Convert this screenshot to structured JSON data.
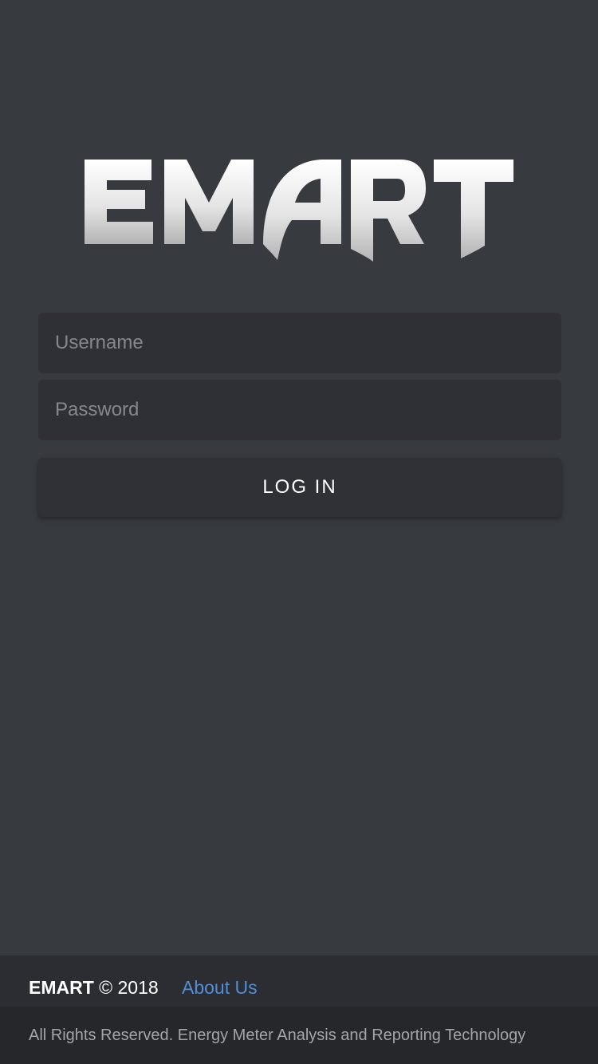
{
  "logo": {
    "text": "EMART"
  },
  "login_form": {
    "username_placeholder": "Username",
    "password_placeholder": "Password",
    "login_label": "LOG IN"
  },
  "footer": {
    "brand": "EMART",
    "copyright": "© 2018",
    "about_label": "About Us",
    "rights_text": "All Rights Reserved. Energy Meter Analysis and Reporting Technology"
  },
  "colors": {
    "background": "#373a3f",
    "input_background": "#2e3035",
    "footer_top": "#2c2d32",
    "footer_bottom": "#26272b",
    "link": "#4f8fd6"
  }
}
